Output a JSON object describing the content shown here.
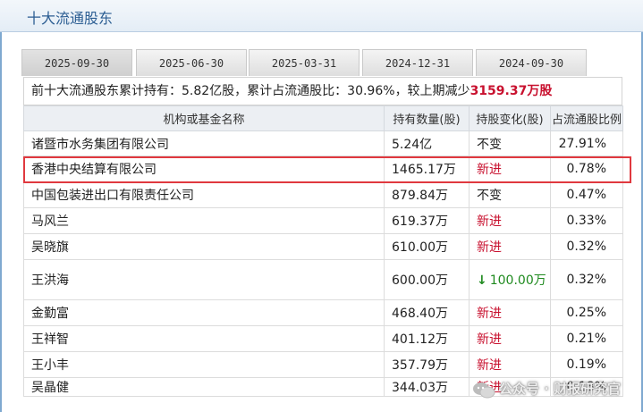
{
  "page": {
    "title": "十大流通股东"
  },
  "tabs": [
    {
      "label": "2025-09-30",
      "active": true
    },
    {
      "label": "2025-06-30",
      "active": false
    },
    {
      "label": "2025-03-31",
      "active": false
    },
    {
      "label": "2024-12-31",
      "active": false
    },
    {
      "label": "2024-09-30",
      "active": false
    }
  ],
  "summary": {
    "prefix": "前十大流通股东累计持有：",
    "total_shares": "5.82亿股",
    "mid": "，累计占流通股比：",
    "ratio": "30.96%",
    "suffix": "，较上期减少",
    "change": "3159.37万股"
  },
  "table": {
    "headers": [
      "机构或基金名称",
      "持有数量(股)",
      "持股变化(股)",
      "占流通股比例"
    ],
    "rows": [
      {
        "name": "诸暨市水务集团有限公司",
        "shares": "5.24亿",
        "change": "不变",
        "change_type": "same",
        "pct": "27.91%"
      },
      {
        "name": "香港中央结算有限公司",
        "shares": "1465.17万",
        "change": "新进",
        "change_type": "new",
        "pct": "0.78%"
      },
      {
        "name": "中国包装进出口有限责任公司",
        "shares": "879.84万",
        "change": "不变",
        "change_type": "same",
        "pct": "0.47%"
      },
      {
        "name": "马风兰",
        "shares": "619.37万",
        "change": "新进",
        "change_type": "new",
        "pct": "0.33%"
      },
      {
        "name": "吴晓旗",
        "shares": "610.00万",
        "change": "新进",
        "change_type": "new",
        "pct": "0.32%"
      },
      {
        "name": "王洪海",
        "shares": "600.00万",
        "change": "100.00万",
        "change_type": "down",
        "pct": "0.32%"
      },
      {
        "name": "金勤富",
        "shares": "468.40万",
        "change": "新进",
        "change_type": "new",
        "pct": "0.25%"
      },
      {
        "name": "王祥智",
        "shares": "401.12万",
        "change": "新进",
        "change_type": "new",
        "pct": "0.21%"
      },
      {
        "name": "王小丰",
        "shares": "357.79万",
        "change": "新进",
        "change_type": "new",
        "pct": "0.19%"
      },
      {
        "name": "吴晶健",
        "shares": "344.03万",
        "change": "新进",
        "change_type": "new",
        "pct": "0.18%"
      }
    ],
    "highlighted_row": 1
  },
  "colors": {
    "title": "#2b5d92",
    "accent_red": "#c8102e",
    "down_green": "#1f8a1f",
    "highlight": "#e0393f"
  },
  "watermark": {
    "text": "公众号 · 财报研究官",
    "icon": "wechat-icon"
  }
}
